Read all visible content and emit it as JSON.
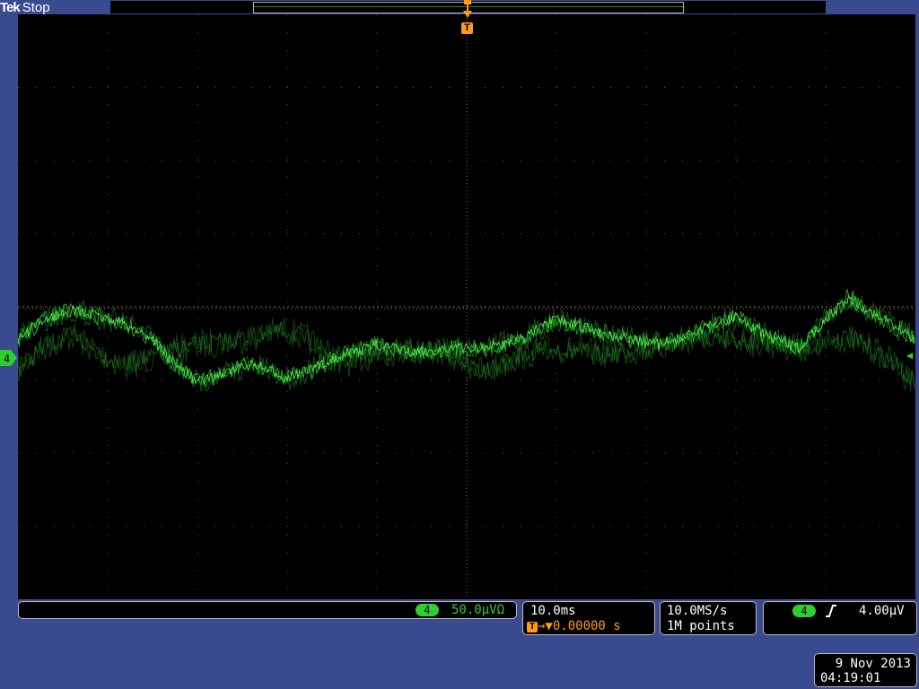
{
  "header": {
    "brand": "Tek",
    "status": "Stop"
  },
  "display": {
    "trace_color": "#2fcf2f",
    "trigger_marker_color": "#ff9a1a",
    "trigger_marker_label": "T",
    "channel_ref_label": "4"
  },
  "channel": {
    "number": "4",
    "scale": "50.0µV",
    "unit_icon": "Ω"
  },
  "horizontal": {
    "time_per_div": "10.0ms",
    "trigger_symbol": "T",
    "position": "→▼0.00000 s"
  },
  "acquisition": {
    "sample_rate": "10.0MS/s",
    "record_length": "1M points"
  },
  "trigger": {
    "source": "4",
    "slope_icon": "rising-edge-icon",
    "level": "4.00µV"
  },
  "timestamp": {
    "date": "9 Nov 2013",
    "time": "04:19:01"
  }
}
